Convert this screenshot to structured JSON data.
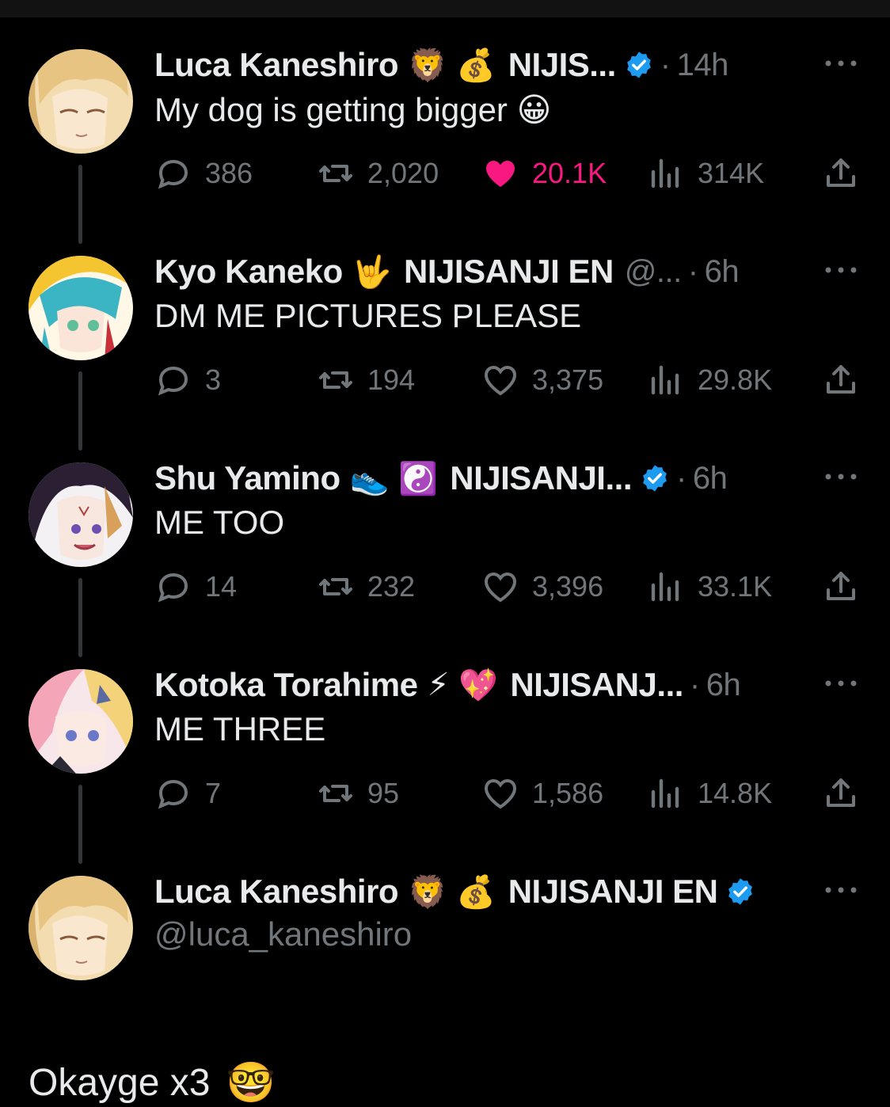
{
  "tweets": [
    {
      "name": "Luca Kaneshiro",
      "emojis": [
        "🦁",
        "💰"
      ],
      "org": "NIJIS...",
      "verified": true,
      "handle": "",
      "time": "14h",
      "text": "My dog is getting bigger 😀",
      "replies": "386",
      "retweets": "2,020",
      "likes": "20.1K",
      "liked": true,
      "views": "314K",
      "avatar_color": "#e8c483"
    },
    {
      "name": "Kyo Kaneko",
      "emojis": [
        "🤟"
      ],
      "org": "NIJISANJI EN",
      "verified": false,
      "handle": "@...",
      "time": "6h",
      "text": "DM ME PICTURES PLEASE",
      "replies": "3",
      "retweets": "194",
      "likes": "3,375",
      "liked": false,
      "views": "29.8K",
      "avatar_color": "#f5c531"
    },
    {
      "name": "Shu Yamino",
      "emojis": [
        "👟",
        "☯️"
      ],
      "org": "NIJISANJI...",
      "verified": true,
      "handle": "",
      "time": "6h",
      "text": "ME TOO",
      "replies": "14",
      "retweets": "232",
      "likes": "3,396",
      "liked": false,
      "views": "33.1K",
      "avatar_color": "#f2f2f2"
    },
    {
      "name": "Kotoka Torahime",
      "emojis": [
        "⚡",
        "💖"
      ],
      "org": "NIJISANJ...",
      "verified": false,
      "handle": "",
      "time": "6h",
      "text": "ME THREE",
      "replies": "7",
      "retweets": "95",
      "likes": "1,586",
      "liked": false,
      "views": "14.8K",
      "avatar_color": "#f4b6c2"
    }
  ],
  "final": {
    "name": "Luca Kaneshiro",
    "emojis": [
      "🦁",
      "💰"
    ],
    "org": "NIJISANJI EN",
    "verified": true,
    "handle": "@luca_kaneshiro",
    "text": "Okayge x3",
    "text_emoji": "🤓"
  },
  "colors": {
    "background": "#000000",
    "text": "#e7e9ea",
    "muted": "#71767b",
    "like": "#f91880",
    "verified": "#1d9bf0"
  }
}
